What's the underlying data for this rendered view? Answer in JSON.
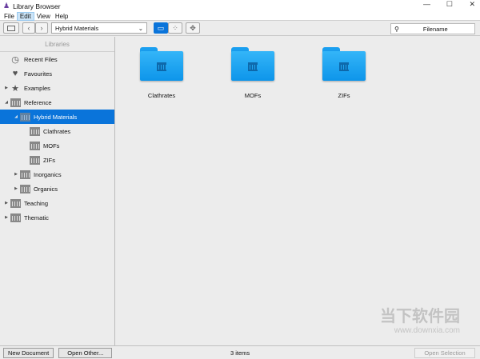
{
  "window": {
    "title": "Library Browser"
  },
  "menu": [
    "File",
    "Edit",
    "View",
    "Help"
  ],
  "toolbar": {
    "library_select": "Hybrid Materials",
    "search_placeholder": "Filename"
  },
  "sidebar": {
    "header": "Libraries",
    "items": [
      {
        "label": "Recent Files",
        "icon": "clock-icon",
        "level": 0,
        "arrow": ""
      },
      {
        "label": "Favourites",
        "icon": "heart-icon",
        "level": 0,
        "arrow": ""
      },
      {
        "label": "Examples",
        "icon": "star-icon",
        "level": 0,
        "arrow": "▶"
      },
      {
        "label": "Reference",
        "icon": "library-icon",
        "level": 0,
        "arrow": "◢"
      },
      {
        "label": "Hybrid Materials",
        "icon": "library-icon",
        "level": 1,
        "arrow": "◢",
        "selected": true
      },
      {
        "label": "Clathrates",
        "icon": "library-icon",
        "level": 2,
        "arrow": ""
      },
      {
        "label": "MOFs",
        "icon": "library-icon",
        "level": 2,
        "arrow": ""
      },
      {
        "label": "ZIFs",
        "icon": "library-icon",
        "level": 2,
        "arrow": ""
      },
      {
        "label": "Inorganics",
        "icon": "library-icon",
        "level": 1,
        "arrow": "▶"
      },
      {
        "label": "Organics",
        "icon": "library-icon",
        "level": 1,
        "arrow": "▶"
      },
      {
        "label": "Teaching",
        "icon": "library-icon",
        "level": 0,
        "arrow": "▶"
      },
      {
        "label": "Thematic",
        "icon": "library-icon",
        "level": 0,
        "arrow": "▶"
      }
    ]
  },
  "folders": [
    "Clathrates",
    "MOFs",
    "ZIFs"
  ],
  "bottom": {
    "new_document": "New Document",
    "open_other": "Open Other...",
    "status": "3 items",
    "open_selection": "Open Selection"
  },
  "watermark": {
    "title": "当下软件园",
    "url": "www.downxia.com"
  }
}
